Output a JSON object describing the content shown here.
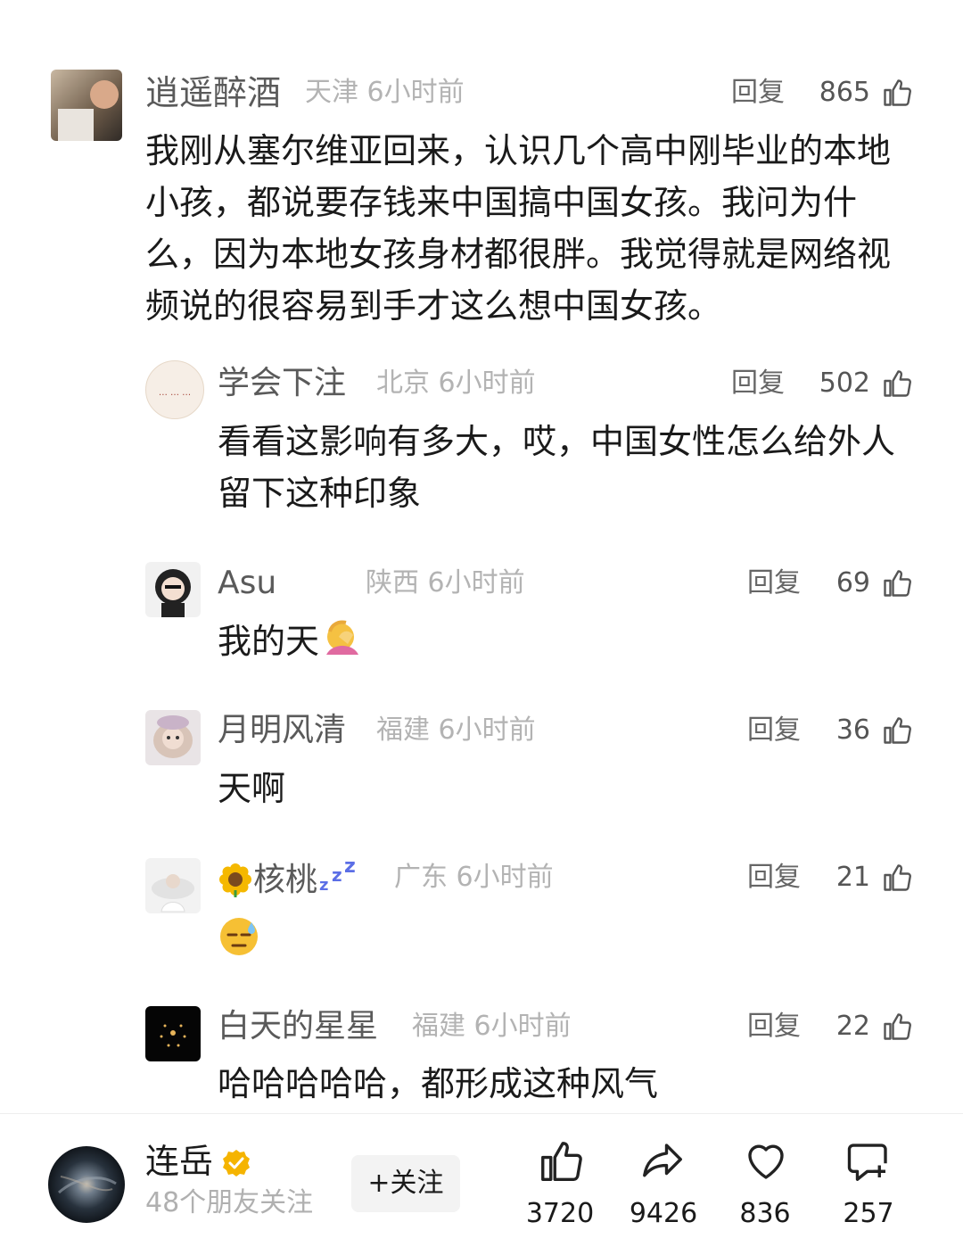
{
  "comments": [
    {
      "name": "逍遥醉酒",
      "location": "天津",
      "time": "6小时前",
      "reply": "回复",
      "likes": "865",
      "text": "我刚从塞尔维亚回来，认识几个高中刚毕业的本地小孩，都说要存钱来中国搞中国女孩。我问为什么，因为本地女孩身材都很胖。我觉得就是网络视频说的很容易到手才这么想中国女孩。"
    },
    {
      "name": "学会下注",
      "location": "北京",
      "time": "6小时前",
      "reply": "回复",
      "likes": "502",
      "text": "看看这影响有多大，哎，中国女性怎么给外人留下这种印象"
    },
    {
      "name": "Asu",
      "location": "陕西",
      "time": "6小时前",
      "reply": "回复",
      "likes": "69",
      "text": "我的天"
    },
    {
      "name": "月明风清",
      "location": "福建",
      "time": "6小时前",
      "reply": "回复",
      "likes": "36",
      "text": "天啊"
    },
    {
      "name": "核桃",
      "location": "广东",
      "time": "6小时前",
      "reply": "回复",
      "likes": "21",
      "text": ""
    },
    {
      "name": "白天的星星",
      "location": "福建",
      "time": "6小时前",
      "reply": "回复",
      "likes": "22",
      "text": "哈哈哈哈哈，都形成这种风气"
    }
  ],
  "icons": {
    "sunflower": "sunflower-icon",
    "zzz": "zzz-icon",
    "face_palm": "face-palm-emoji",
    "sweat": "sweat-emoji"
  },
  "footer": {
    "author": "连岳",
    "friends": "48个朋友关注",
    "follow": "+关注",
    "likes": "3720",
    "shares": "9426",
    "hearts": "836",
    "comments": "257"
  },
  "colors": {
    "verified": "#f5b400",
    "accent": "#1a1a1a"
  }
}
